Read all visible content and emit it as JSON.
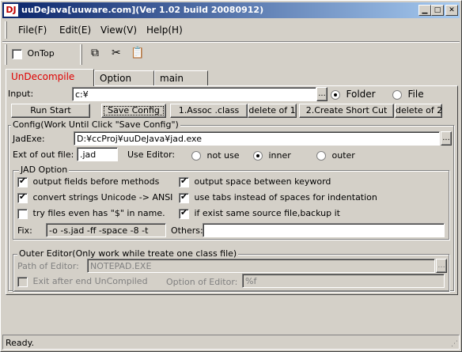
{
  "window": {
    "icon_text": "DJ",
    "title": "uuDeJava[uuware.com](Ver 1.02 build 20080912)",
    "controls": [
      "minimize-icon",
      "maximize-icon",
      "close-icon"
    ]
  },
  "menu": {
    "items": [
      {
        "label": "File(F)"
      },
      {
        "label": "Edit(E)"
      },
      {
        "label": "View(V)"
      },
      {
        "label": "Help(H)"
      }
    ]
  },
  "toolbar": {
    "ontop_label": "OnTop",
    "ontop_checked": false,
    "icons": [
      "copy-icon",
      "cut-icon",
      "paste-icon"
    ]
  },
  "tabs": [
    {
      "label": "UnDecompile",
      "active": true
    },
    {
      "label": "Option",
      "active": false
    },
    {
      "label": "main",
      "active": false
    }
  ],
  "input": {
    "label": "Input:",
    "value": "c:¥",
    "browse": "...",
    "folder_label": "Folder",
    "file_label": "File",
    "selected": "Folder"
  },
  "actions": {
    "run_start": "Run Start",
    "save_config": "Save Config",
    "assoc_class": "1.Assoc .class",
    "delete1": "delete of 1",
    "create_shortcut": "2.Create Short Cut",
    "delete2": "delete of 2"
  },
  "config": {
    "legend": "Config(Work Until Click \"Save Config\")",
    "jadexe_label": "JadExe:",
    "jadexe_value": "D:¥ccProj¥uuDeJava¥jad.exe",
    "browse": "...",
    "ext_label": "Ext of out file:",
    "ext_value": ".jad",
    "use_editor_label": "Use Editor:",
    "editor_options": [
      "not use",
      "inner",
      "outer"
    ],
    "editor_selected": "inner"
  },
  "jad": {
    "legend": "JAD Option",
    "options": [
      {
        "label": "output fields before methods",
        "checked": true
      },
      {
        "label": "output space between keyword",
        "checked": true
      },
      {
        "label": "convert strings Unicode -> ANSI",
        "checked": true
      },
      {
        "label": "use tabs instead of spaces for indentation",
        "checked": true
      },
      {
        "label": "try files even has \"$\" in name.",
        "checked": false
      },
      {
        "label": "if exist same source file,backup it",
        "checked": true
      }
    ],
    "fix_label": "Fix:",
    "fix_value": "-o -s.jad -ff -space -8 -t",
    "others_label": "Others:",
    "others_value": ""
  },
  "outer_editor": {
    "legend": "Outer Editor(Only work while treate one class file)",
    "path_label": "Path of Editor:",
    "path_value": "NOTEPAD.EXE",
    "browse": "...",
    "exit_label": "Exit after end UnCompiled",
    "option_label": "Option of Editor:",
    "option_value": "%f"
  },
  "status": {
    "text": "Ready."
  }
}
